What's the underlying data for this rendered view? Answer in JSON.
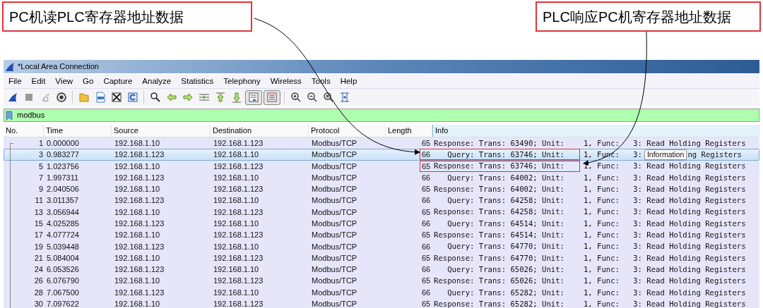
{
  "callouts": [
    {
      "text": "PC机读PLC寄存器地址数据"
    },
    {
      "text": "PLC响应PC机寄存器地址数据"
    }
  ],
  "window": {
    "title": "*Local Area Connection"
  },
  "menu": [
    "File",
    "Edit",
    "View",
    "Go",
    "Capture",
    "Analyze",
    "Statistics",
    "Telephony",
    "Wireless",
    "Tools",
    "Help"
  ],
  "toolbar": [
    {
      "kind": "start",
      "pressed": false
    },
    {
      "kind": "stop",
      "pressed": false
    },
    {
      "kind": "restart",
      "pressed": false
    },
    {
      "kind": "options",
      "pressed": false
    },
    {
      "kind": "sep"
    },
    {
      "kind": "open",
      "pressed": false
    },
    {
      "kind": "save",
      "pressed": false
    },
    {
      "kind": "close",
      "pressed": false
    },
    {
      "kind": "reload",
      "pressed": false
    },
    {
      "kind": "sep"
    },
    {
      "kind": "find",
      "pressed": false
    },
    {
      "kind": "back",
      "pressed": false
    },
    {
      "kind": "forward",
      "pressed": false
    },
    {
      "kind": "goto",
      "pressed": false
    },
    {
      "kind": "first",
      "pressed": false
    },
    {
      "kind": "last",
      "pressed": false
    },
    {
      "kind": "autoscroll",
      "pressed": true
    },
    {
      "kind": "colorize",
      "pressed": true
    },
    {
      "kind": "sep"
    },
    {
      "kind": "zoomin",
      "pressed": false
    },
    {
      "kind": "zoomout",
      "pressed": false
    },
    {
      "kind": "zoomreset",
      "pressed": false
    },
    {
      "kind": "resize",
      "pressed": false
    }
  ],
  "filter": {
    "value": "modbus"
  },
  "table": {
    "columns": [
      "No.",
      "Time",
      "Source",
      "Destination",
      "Protocol",
      "Length",
      "Info"
    ],
    "rows": [
      {
        "no": "1",
        "time": "0.000000",
        "source": "192.168.1.10",
        "destination": "192.168.1.123",
        "protocol": "Modbus/TCP",
        "length": "65",
        "info_head": "Response: Trans: 63490; Unit:",
        "info_tail": "1, Func:   3: Read Holding Registers",
        "selected": false,
        "highlighted": false
      },
      {
        "no": "3",
        "time": "0.983277",
        "source": "192.168.1.123",
        "destination": "192.168.1.10",
        "protocol": "Modbus/TCP",
        "length": "66",
        "info_head": "   Query: Trans: 63746; Unit:",
        "info_tail": "1, Func:   3:",
        "selected": true,
        "highlighted": true
      },
      {
        "no": "5",
        "time": "1.023756",
        "source": "192.168.1.10",
        "destination": "192.168.1.123",
        "protocol": "Modbus/TCP",
        "length": "65",
        "info_head": "Response: Trans: 63746; Unit:",
        "info_tail": "1, Func:   3: Read Holding Registers",
        "selected": false,
        "highlighted": true
      },
      {
        "no": "7",
        "time": "1.997311",
        "source": "192.168.1.123",
        "destination": "192.168.1.10",
        "protocol": "Modbus/TCP",
        "length": "66",
        "info_head": "   Query: Trans: 64002; Unit:",
        "info_tail": "1, Func:   3: Read Holding Registers",
        "selected": false,
        "highlighted": false
      },
      {
        "no": "9",
        "time": "2.040506",
        "source": "192.168.1.10",
        "destination": "192.168.1.123",
        "protocol": "Modbus/TCP",
        "length": "65",
        "info_head": "Response: Trans: 64002; Unit:",
        "info_tail": "1, Func:   3: Read Holding Registers",
        "selected": false,
        "highlighted": false
      },
      {
        "no": "11",
        "time": "3.011357",
        "source": "192.168.1.123",
        "destination": "192.168.1.10",
        "protocol": "Modbus/TCP",
        "length": "66",
        "info_head": "   Query: Trans: 64258; Unit:",
        "info_tail": "1, Func:   3: Read Holding Registers",
        "selected": false,
        "highlighted": false
      },
      {
        "no": "13",
        "time": "3.056944",
        "source": "192.168.1.10",
        "destination": "192.168.1.123",
        "protocol": "Modbus/TCP",
        "length": "65",
        "info_head": "Response: Trans: 64258; Unit:",
        "info_tail": "1, Func:   3: Read Holding Registers",
        "selected": false,
        "highlighted": false
      },
      {
        "no": "15",
        "time": "4.025285",
        "source": "192.168.1.123",
        "destination": "192.168.1.10",
        "protocol": "Modbus/TCP",
        "length": "66",
        "info_head": "   Query: Trans: 64514; Unit:",
        "info_tail": "1, Func:   3: Read Holding Registers",
        "selected": false,
        "highlighted": false
      },
      {
        "no": "17",
        "time": "4.077724",
        "source": "192.168.1.10",
        "destination": "192.168.1.123",
        "protocol": "Modbus/TCP",
        "length": "65",
        "info_head": "Response: Trans: 64514; Unit:",
        "info_tail": "1, Func:   3: Read Holding Registers",
        "selected": false,
        "highlighted": false
      },
      {
        "no": "19",
        "time": "5.039448",
        "source": "192.168.1.123",
        "destination": "192.168.1.10",
        "protocol": "Modbus/TCP",
        "length": "66",
        "info_head": "   Query: Trans: 64770; Unit:",
        "info_tail": "1, Func:   3: Read Holding Registers",
        "selected": false,
        "highlighted": false
      },
      {
        "no": "21",
        "time": "5.084004",
        "source": "192.168.1.10",
        "destination": "192.168.1.123",
        "protocol": "Modbus/TCP",
        "length": "65",
        "info_head": "Response: Trans: 64770; Unit:",
        "info_tail": "1, Func:   3: Read Holding Registers",
        "selected": false,
        "highlighted": false
      },
      {
        "no": "24",
        "time": "6.053526",
        "source": "192.168.1.123",
        "destination": "192.168.1.10",
        "protocol": "Modbus/TCP",
        "length": "66",
        "info_head": "   Query: Trans: 65026; Unit:",
        "info_tail": "1, Func:   3: Read Holding Registers",
        "selected": false,
        "highlighted": false
      },
      {
        "no": "26",
        "time": "6.076790",
        "source": "192.168.1.10",
        "destination": "192.168.1.123",
        "protocol": "Modbus/TCP",
        "length": "65",
        "info_head": "Response: Trans: 65026; Unit:",
        "info_tail": "1, Func:   3: Read Holding Registers",
        "selected": false,
        "highlighted": false
      },
      {
        "no": "28",
        "time": "7.067500",
        "source": "192.168.1.123",
        "destination": "192.168.1.10",
        "protocol": "Modbus/TCP",
        "length": "66",
        "info_head": "   Query: Trans: 65282; Unit:",
        "info_tail": "1, Func:   3: Read Holding Registers",
        "selected": false,
        "highlighted": false
      },
      {
        "no": "30",
        "time": "7.097622",
        "source": "192.168.1.10",
        "destination": "192.168.1.123",
        "protocol": "Modbus/TCP",
        "length": "65",
        "info_head": "Response: Trans: 65282; Unit:",
        "info_tail": "1, Func:   3: Read Holding Registers",
        "selected": false,
        "highlighted": false
      }
    ]
  },
  "tooltip": {
    "text": "Information",
    "info_tail": "ng Registers"
  }
}
